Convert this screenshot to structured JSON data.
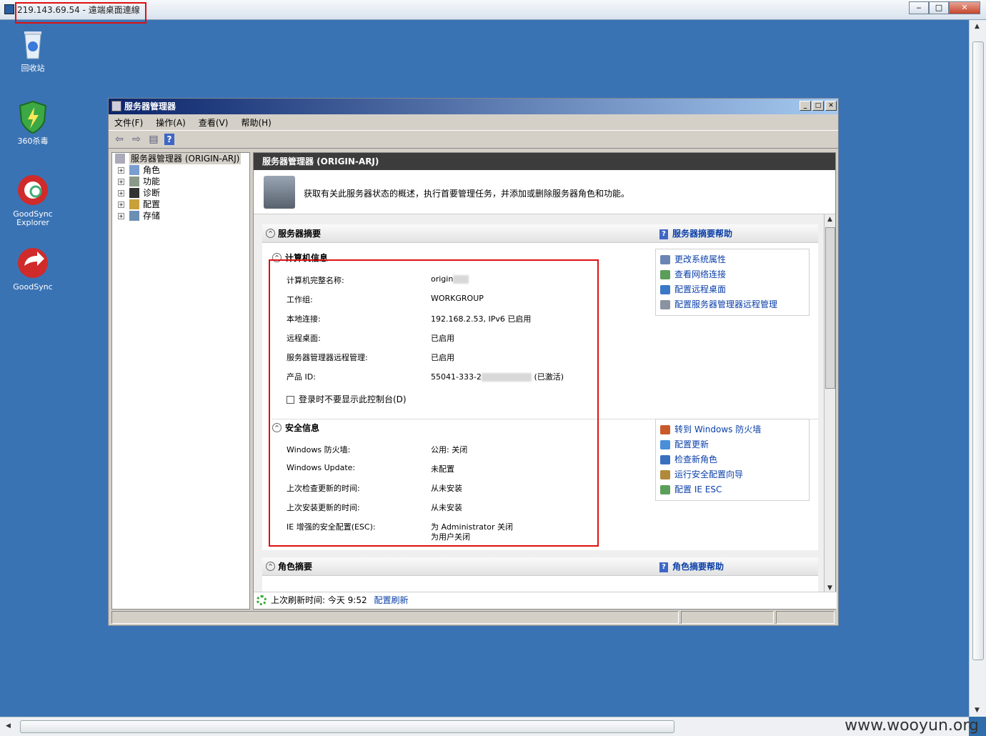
{
  "rdp": {
    "title": "219.143.69.54 - 遠端桌面連線",
    "btn_min": "‒",
    "btn_max": "□",
    "btn_close": "✕"
  },
  "desktop_icons": [
    {
      "label": "回收站",
      "name": "recycle-bin-icon"
    },
    {
      "label": "360杀毒",
      "name": "antivirus-360-icon"
    },
    {
      "label": "GoodSync Explorer",
      "name": "goodsync-explorer-icon"
    },
    {
      "label": "GoodSync",
      "name": "goodsync-icon"
    }
  ],
  "watermark": "www.wooyun.org",
  "window": {
    "title": "服务器管理器",
    "menu": [
      "文件(F)",
      "操作(A)",
      "查看(V)",
      "帮助(H)"
    ],
    "tree": {
      "root": "服务器管理器 (ORIGIN-ARJ)",
      "items": [
        "角色",
        "功能",
        "诊断",
        "配置",
        "存储"
      ]
    },
    "header": "服务器管理器 (ORIGIN-ARJ)",
    "intro": "获取有关此服务器状态的概述，执行首要管理任务，并添加或删除服务器角色和功能。",
    "summary": {
      "title": "服务器摘要",
      "help": "服务器摘要帮助",
      "computer_info": {
        "title": "计算机信息",
        "rows": [
          {
            "label": "计算机完整名称:",
            "value": "origin"
          },
          {
            "label": "工作组:",
            "value": "WORKGROUP"
          },
          {
            "label": "本地连接:",
            "value": "192.168.2.53, IPv6 已启用"
          },
          {
            "label": "远程桌面:",
            "value": "已启用"
          },
          {
            "label": "服务器管理器远程管理:",
            "value": "已启用"
          },
          {
            "label": "产品 ID:",
            "value": "55041-333-2",
            "suffix": "(已激活)"
          }
        ],
        "checkbox": "登录时不要显示此控制台(D)",
        "tasks": [
          "更改系统属性",
          "查看网络连接",
          "配置远程桌面",
          "配置服务器管理器远程管理"
        ]
      },
      "security": {
        "title": "安全信息",
        "rows": [
          {
            "label": "Windows 防火墙:",
            "value": "公用: 关闭"
          },
          {
            "label": "Windows Update:",
            "value": "未配置"
          },
          {
            "label": "上次检查更新的时间:",
            "value": "从未安装"
          },
          {
            "label": "上次安装更新的时间:",
            "value": "从未安装"
          },
          {
            "label": "IE 增强的安全配置(ESC):",
            "value": "为 Administrator 关闭",
            "value2": "为用户关闭"
          }
        ],
        "tasks": [
          "转到 Windows 防火墙",
          "配置更新",
          "检查新角色",
          "运行安全配置向导",
          "配置 IE ESC"
        ]
      }
    },
    "roles": {
      "title": "角色摘要",
      "help": "角色摘要帮助"
    },
    "status": {
      "text": "上次刷新时间: 今天 9:52",
      "link": "配置刷新"
    }
  }
}
